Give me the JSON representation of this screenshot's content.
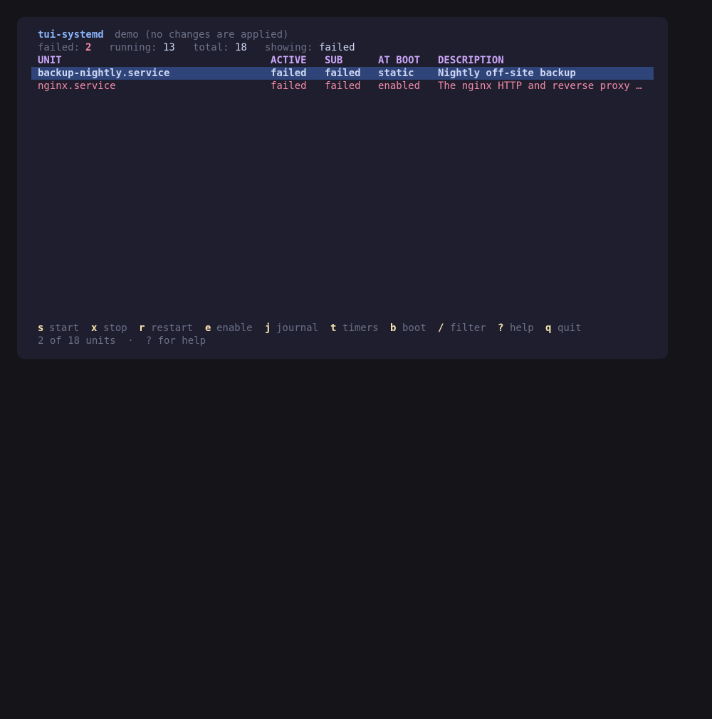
{
  "header": {
    "app_name": "tui-systemd",
    "mode_note": "demo (no changes are applied)"
  },
  "stats": {
    "failed_label": "failed:",
    "failed_value": "2",
    "running_label": "running:",
    "running_value": "13",
    "total_label": "total:",
    "total_value": "18",
    "showing_label": "showing:",
    "showing_value": "failed"
  },
  "table": {
    "columns": [
      "UNIT",
      "ACTIVE",
      "SUB",
      "AT BOOT",
      "DESCRIPTION"
    ],
    "rows": [
      {
        "unit": "backup-nightly.service",
        "active": "failed",
        "sub": "failed",
        "at_boot": "static",
        "description": "Nightly off-site backup",
        "selected": true
      },
      {
        "unit": "nginx.service",
        "active": "failed",
        "sub": "failed",
        "at_boot": "enabled",
        "description": "The nginx HTTP and reverse proxy …",
        "selected": false
      }
    ]
  },
  "keybar": [
    {
      "key": "s",
      "label": "start"
    },
    {
      "key": "x",
      "label": "stop"
    },
    {
      "key": "r",
      "label": "restart"
    },
    {
      "key": "e",
      "label": "enable"
    },
    {
      "key": "j",
      "label": "journal"
    },
    {
      "key": "t",
      "label": "timers"
    },
    {
      "key": "b",
      "label": "boot"
    },
    {
      "key": "/",
      "label": "filter"
    },
    {
      "key": "?",
      "label": "help"
    },
    {
      "key": "q",
      "label": "quit"
    }
  ],
  "statusbar": {
    "text": "2 of 18 units  ·  ? for help"
  },
  "colors": {
    "background": "#1e1e2e",
    "selection": "#2f4478",
    "failed": "#f38ba8",
    "header": "#cba6f7",
    "key": "#f9e2af",
    "title": "#89b4fa"
  }
}
